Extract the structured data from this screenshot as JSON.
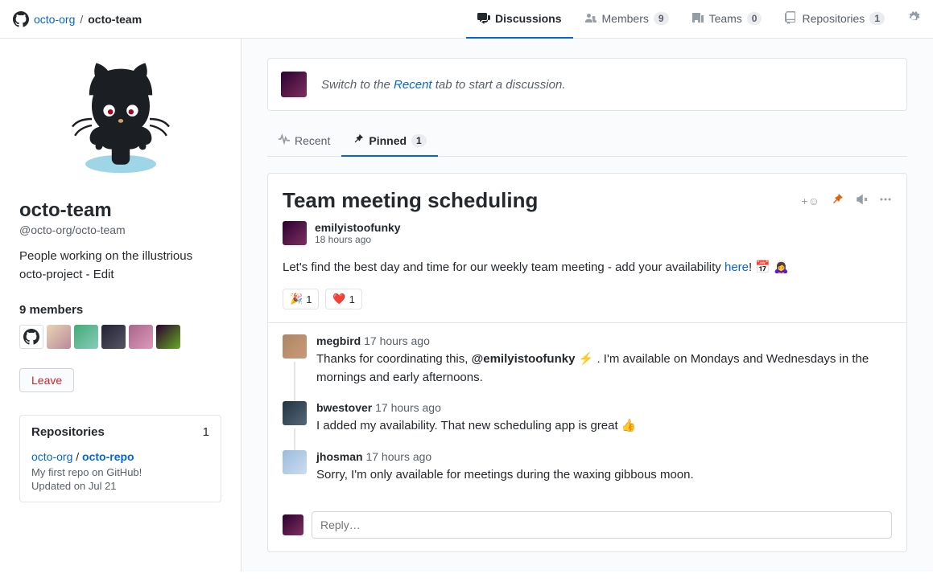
{
  "breadcrumb": {
    "org": "octo-org",
    "team": "octo-team"
  },
  "nav": {
    "discussions": "Discussions",
    "members": "Members",
    "members_count": "9",
    "teams": "Teams",
    "teams_count": "0",
    "repositories": "Repositories",
    "repositories_count": "1"
  },
  "sidebar": {
    "team_name": "octo-team",
    "team_slug": "@octo-org/octo-team",
    "description": "People working on the illustrious octo-project - Edit",
    "members_heading": "9 members",
    "leave_label": "Leave",
    "repos_heading": "Repositories",
    "repos_count": "1",
    "repo": {
      "org": "octo-org",
      "sep": " / ",
      "name": "octo-repo",
      "desc": "My first repo on GitHub!",
      "updated": "Updated on Jul 21"
    }
  },
  "banner": {
    "prefix": "Switch to the ",
    "link": "Recent",
    "suffix": " tab to start a discussion."
  },
  "subtabs": {
    "recent": "Recent",
    "pinned": "Pinned",
    "pinned_count": "1"
  },
  "discussion": {
    "title": "Team meeting scheduling",
    "author": "emilyistoofunky",
    "time": "18 hours ago",
    "body_prefix": "Let's find the best day and time for our weekly team meeting - add your availability ",
    "body_link": "here",
    "body_suffix": "! 📅 🙇‍♀️",
    "reactions": [
      {
        "emoji": "🎉",
        "count": "1"
      },
      {
        "emoji": "❤️",
        "count": "1"
      }
    ],
    "comments": [
      {
        "author": "megbird",
        "time": "17 hours ago",
        "text_before": "Thanks for coordinating this, ",
        "mention": "@emilyistoofunky",
        "text_after": " ⚡ . I'm available on Mondays and Wednesdays in the mornings and early afternoons."
      },
      {
        "author": "bwestover",
        "time": "17 hours ago",
        "text_before": "I added my availability. That new scheduling app is great 👍",
        "mention": "",
        "text_after": ""
      },
      {
        "author": "jhosman",
        "time": "17 hours ago",
        "text_before": "Sorry, I'm only available for meetings during the waxing gibbous moon.",
        "mention": "",
        "text_after": ""
      }
    ],
    "reply_placeholder": "Reply…"
  }
}
